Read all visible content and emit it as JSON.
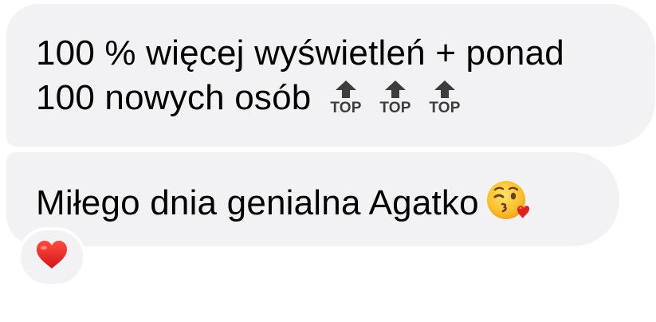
{
  "messages": [
    {
      "line1": "100 % więcej wyświetleń + ponad",
      "line2": "100 nowych osób",
      "emojis": [
        "top-arrow",
        "top-arrow",
        "top-arrow"
      ],
      "emoji_label": "TOP"
    },
    {
      "text": "Miłego dnia genialna Agatko",
      "emoji": "face-blowing-a-kiss"
    }
  ],
  "reaction": {
    "emoji": "red-heart",
    "color": "#e0211d"
  },
  "colors": {
    "bubble": "#f2f2f4",
    "text": "#000000",
    "top_icon": "#3d3d3d"
  }
}
